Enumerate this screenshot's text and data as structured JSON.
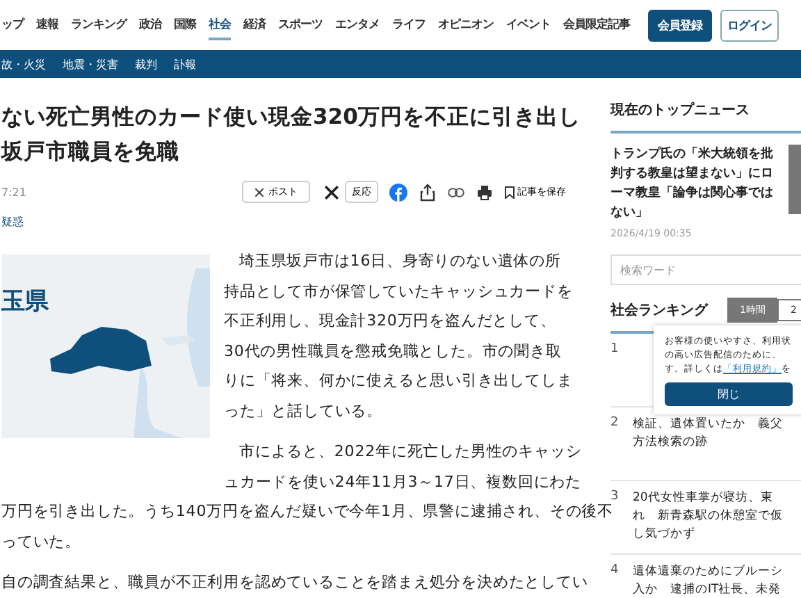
{
  "nav": {
    "items": [
      {
        "label": "ップ",
        "selected": false
      },
      {
        "label": "速報",
        "selected": false
      },
      {
        "label": "ランキング",
        "selected": false
      },
      {
        "label": "政治",
        "selected": false
      },
      {
        "label": "国際",
        "selected": false
      },
      {
        "label": "社会",
        "selected": true
      },
      {
        "label": "経済",
        "selected": false
      },
      {
        "label": "スポーツ",
        "selected": false
      },
      {
        "label": "エンタメ",
        "selected": false
      },
      {
        "label": "ライフ",
        "selected": false
      },
      {
        "label": "オピニオン",
        "selected": false
      },
      {
        "label": "イベント",
        "selected": false
      },
      {
        "label": "会員限定記事",
        "selected": false
      }
    ],
    "register": "会員登録",
    "login": "ログイン"
  },
  "subnav": [
    "故・火災",
    "地震・災害",
    "裁判",
    "訃報"
  ],
  "article": {
    "headline": [
      "ない死亡男性のカード使い現金320万円を不正に引き出し",
      "坂戸市職員を免職"
    ],
    "time": "7:21",
    "post": "ポスト",
    "reactions": "反応",
    "save": "記事を保存",
    "tag": "疑惑",
    "map_label": "玉県",
    "lead": "埼玉県坂戸市は16日、身寄りのない遺体の所持品として市が保管していたキャッシュカードを不正利用し、現金計320万円を盗んだとして、30代の男性職員を懲戒免職とした。市の聞き取りに「将来、何かに使えると思い引き出してしまった」と話している。",
    "side_lines": [
      "市によると、2022年に死亡した男性のキャッシ",
      "ュカードを使い24年11月3～17日、複数回にわた"
    ],
    "full_lines": [
      "万円を引き出した。うち140万円を盗んだ疑いで今年1月、県警に逮捕され、その後不",
      "っていた。"
    ],
    "last": "自の調査結果と、職員が不正利用を認めていることを踏まえ処分を決めたとしてい"
  },
  "sidebar": {
    "top_title": "現在のトップニュース",
    "top_headline": "トランプ氏の「米大統領を批判する教皇は望まない」にローマ教皇「論争は関心事ではない」",
    "top_date": "2026/4/19 00:35",
    "search": {
      "placeholder": "検索ワード"
    },
    "ranking_title": "社会ランキング",
    "ranking_tabs": [
      {
        "label": "1時間",
        "selected": true
      },
      {
        "label": "2",
        "selected": false
      }
    ],
    "ranking": [
      {
        "rank": "1"
      },
      {
        "rank": "2",
        "lines": [
          "検証、遺体置いたか　義父",
          "方法検索の跡"
        ]
      },
      {
        "rank": "3",
        "lines": [
          "20代女性車掌が寝坊、東",
          "れ　新青森駅の休憩室で仮",
          "し気づかず"
        ]
      },
      {
        "rank": "4",
        "lines": [
          "遺体遺棄のためにブルーシ",
          "入か　逮捕のIT社長、未発"
        ]
      }
    ],
    "notice": {
      "before": "お客様の使いやすさ、利用状の高い広告配信のために、す。詳しくは",
      "link": "「利用規約」",
      "after": "を",
      "button": "閉じ"
    }
  }
}
